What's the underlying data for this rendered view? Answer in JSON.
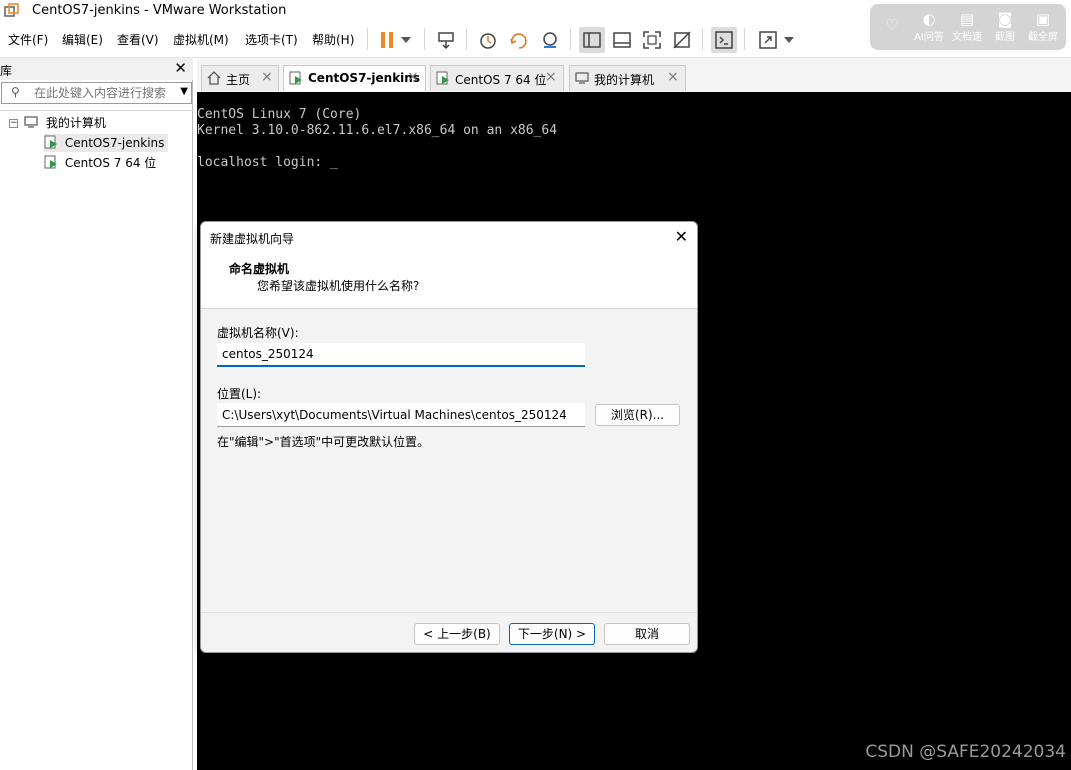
{
  "window": {
    "title": "CentOS7-jenkins - VMware Workstation"
  },
  "menubar": {
    "items": [
      "文件(F)",
      "编辑(E)",
      "查看(V)",
      "虚拟机(M)",
      "选项卡(T)",
      "帮助(H)"
    ]
  },
  "overlay_widget": {
    "items": [
      "AI问答",
      "文档速",
      "截图",
      "截全屏"
    ]
  },
  "library": {
    "title": "库",
    "search_placeholder": "在此处键入内容进行搜索",
    "root": "我的计算机",
    "vms": [
      "CentOS7-jenkins",
      "CentOS 7 64 位"
    ]
  },
  "tabs": [
    {
      "label": "主页",
      "icon": "home-icon"
    },
    {
      "label": "CentOS7-jenkins",
      "icon": "vm-running-icon"
    },
    {
      "label": "CentOS 7 64 位",
      "icon": "vm-running-icon"
    },
    {
      "label": "我的计算机",
      "icon": "computer-icon"
    }
  ],
  "console": {
    "lines": [
      "CentOS Linux 7 (Core)",
      "Kernel 3.10.0-862.11.6.el7.x86_64 on an x86_64",
      "",
      "localhost login: _"
    ]
  },
  "dialog": {
    "title": "新建虚拟机向导",
    "heading": "命名虚拟机",
    "subheading": "您希望该虚拟机使用什么名称?",
    "name_label": "虚拟机名称(V):",
    "name_value": "centos_250124",
    "location_label": "位置(L):",
    "location_value": "C:\\Users\\xyt\\Documents\\Virtual Machines\\centos_250124",
    "browse_label": "浏览(R)...",
    "hint": "在\"编辑\">\"首选项\"中可更改默认位置。",
    "back_label": "< 上一步(B)",
    "next_label": "下一步(N) >",
    "cancel_label": "取消"
  },
  "watermark": "CSDN @SAFE20242034",
  "colors": {
    "accent": "#0067c0",
    "pause_orange": "#f08a24",
    "vm_green": "#2e9a3e",
    "console_bg": "#000000"
  }
}
